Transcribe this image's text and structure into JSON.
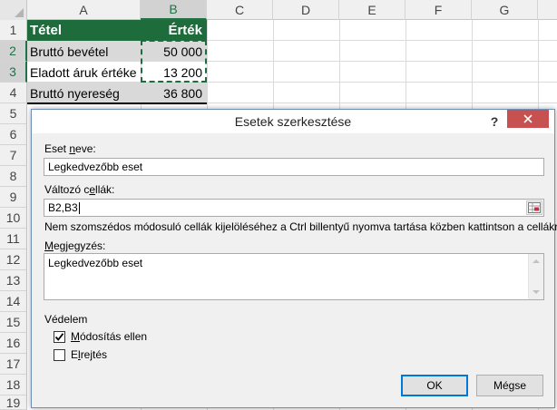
{
  "sheet": {
    "columns": [
      "A",
      "B",
      "C",
      "D",
      "E",
      "F",
      "G"
    ],
    "rows": [
      "1",
      "2",
      "3",
      "4",
      "5",
      "6",
      "7",
      "8",
      "9",
      "10",
      "11",
      "12",
      "13",
      "14",
      "15",
      "16",
      "17",
      "18",
      "19"
    ],
    "cells": {
      "a1": "Tétel",
      "b1": "Érték",
      "a2": "Bruttó bevétel",
      "b2": "50 000",
      "a3": "Eladott áruk értéke",
      "b3": "13 200",
      "a4": "Bruttó nyereség",
      "b4": "36 800"
    },
    "colors": {
      "header_bg": "#1e6b3c",
      "cell_gray": "#d9d9d9"
    }
  },
  "dialog": {
    "title": "Esetek szerkesztése",
    "help": "?",
    "close_icon": "close-icon",
    "scenario_name_label_pre": "Eset ",
    "scenario_name_label_u": "n",
    "scenario_name_label_post": "eve:",
    "scenario_name_value": "Legkedvezőbb eset",
    "changing_cells_label_pre": "Változó c",
    "changing_cells_label_u": "e",
    "changing_cells_label_post": "llák:",
    "changing_cells_value": "B2,B3",
    "hint": "Nem szomszédos módosuló cellák kijelöléséhez a Ctrl billentyű nyomva tartása közben kattintson a cellákra.",
    "comment_label_pre": "",
    "comment_label_u": "M",
    "comment_label_post": "egjegyzés:",
    "comment_value": "Legkedvezőbb eset",
    "protection_label": "Védelem",
    "prevent_changes_pre": "",
    "prevent_changes_u": "M",
    "prevent_changes_post": "ódosítás ellen",
    "prevent_changes_checked": true,
    "hide_pre": "E",
    "hide_u": "l",
    "hide_post": "rejtés",
    "hide_checked": false,
    "ok_label": "OK",
    "cancel_label": "Mégse"
  }
}
